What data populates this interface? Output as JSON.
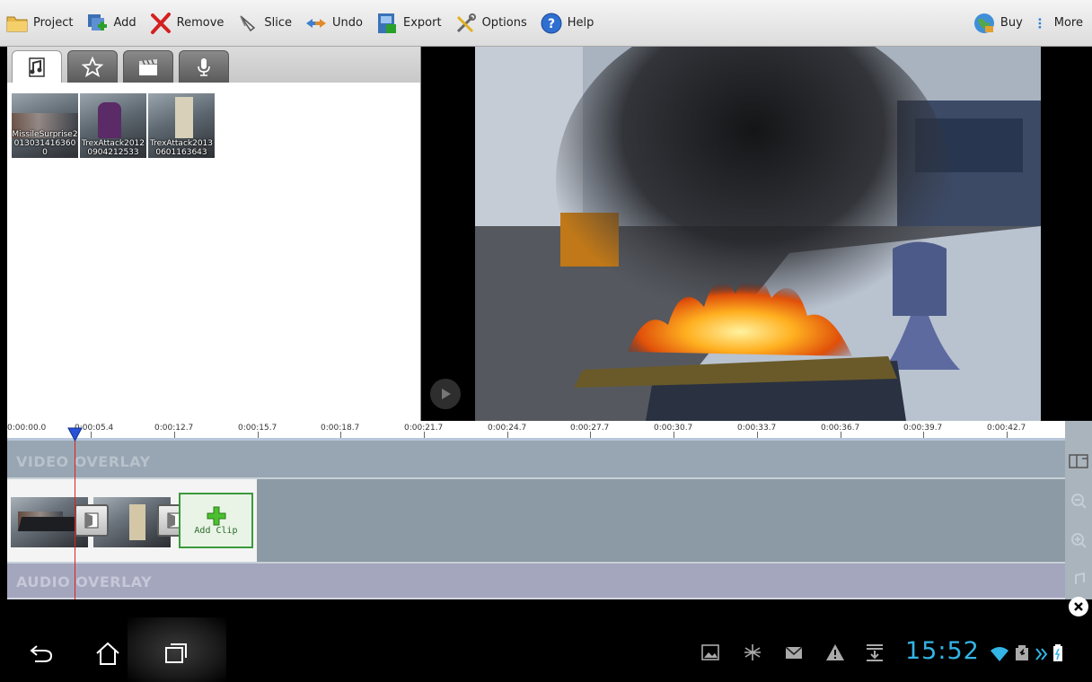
{
  "toolbar": {
    "project_label": "Project",
    "add_label": "Add",
    "remove_label": "Remove",
    "slice_label": "Slice",
    "undo_label": "Undo",
    "export_label": "Export",
    "options_label": "Options",
    "help_label": "Help",
    "buy_label": "Buy",
    "more_label": "More"
  },
  "library": {
    "tabs": [
      "music-icon",
      "star-icon",
      "clapperboard-icon",
      "microphone-icon"
    ],
    "active_tab": "music-icon",
    "items": [
      {
        "caption": "MissileSurprise20130314163600"
      },
      {
        "caption": "TrexAttack20120904212533"
      },
      {
        "caption": "TrexAttack20130601163643"
      }
    ]
  },
  "timeline": {
    "ticks": [
      "0:00:00.0",
      "0:00:05.4",
      "0:00:12.7",
      "0:00:15.7",
      "0:00:18.7",
      "0:00:21.7",
      "0:00:24.7",
      "0:00:27.7",
      "0:00:30.7",
      "0:00:33.7",
      "0:00:36.7",
      "0:00:39.7",
      "0:00:42.7"
    ],
    "video_overlay_label": "VIDEO OVERLAY",
    "audio_overlay_label": "AUDIO OVERLAY",
    "add_clip_label": "Add Clip"
  },
  "status_bar": {
    "time": "15:52"
  },
  "colors": {
    "clock": "#33b5e5",
    "playhead": "#e02020",
    "add_clip_border": "#3b9a3b"
  }
}
